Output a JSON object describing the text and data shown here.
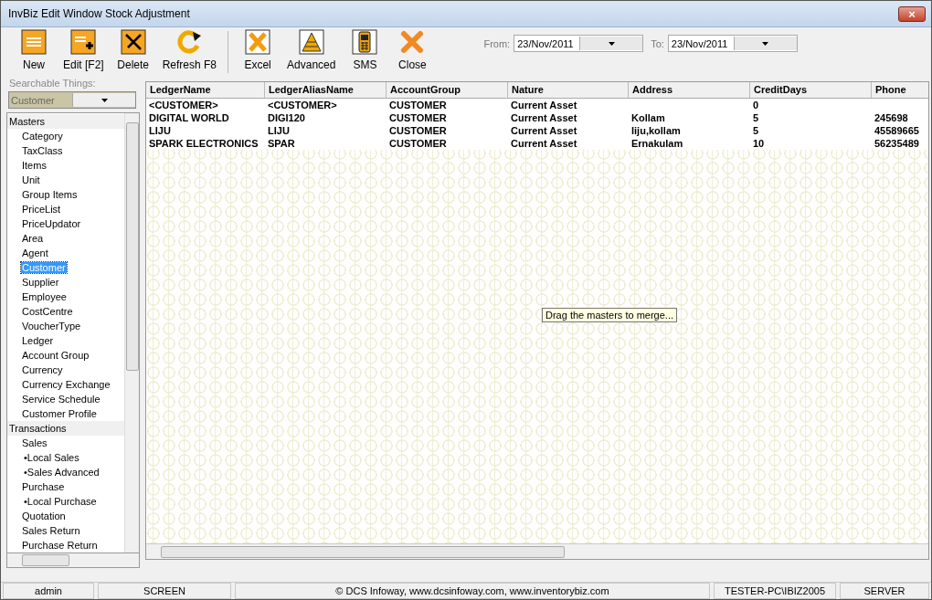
{
  "window": {
    "title": "InvBiz Edit Window Stock Adjustment",
    "close": "×"
  },
  "toolbar": [
    "New",
    "Edit [F2]",
    "Delete",
    "Refresh F8",
    "Excel",
    "Advanced",
    "SMS",
    "Close"
  ],
  "dates": [
    {
      "label": "From:",
      "value": "23/Nov/2011"
    },
    {
      "label": "To:",
      "value": "23/Nov/2011"
    }
  ],
  "search": {
    "label": "Searchable Things:",
    "value": "Customer"
  },
  "sidebar": {
    "items": [
      {
        "label": "Masters",
        "children": [
          {
            "label": "Category",
            "selected": false
          },
          {
            "label": "TaxClass",
            "selected": false
          },
          {
            "label": "Items",
            "selected": false
          },
          {
            "label": "Unit",
            "selected": false
          },
          {
            "label": "Group Items",
            "selected": false
          },
          {
            "label": "PriceList",
            "selected": false
          },
          {
            "label": "PriceUpdator",
            "selected": false
          },
          {
            "label": "Area",
            "selected": false
          },
          {
            "label": "Agent",
            "selected": false
          },
          {
            "label": "Customer",
            "selected": true
          },
          {
            "label": "Supplier",
            "selected": false
          },
          {
            "label": "Employee",
            "selected": false
          },
          {
            "label": "CostCentre",
            "selected": false
          },
          {
            "label": "VoucherType",
            "selected": false
          },
          {
            "label": "Ledger",
            "selected": false
          },
          {
            "label": "Account Group",
            "selected": false
          },
          {
            "label": "Currency",
            "selected": false
          },
          {
            "label": "Currency Exchange",
            "selected": false
          },
          {
            "label": "Service Schedule",
            "selected": false
          },
          {
            "label": "Customer Profile",
            "selected": false
          }
        ]
      },
      {
        "label": "Transactions",
        "children": [
          {
            "label": "Sales",
            "selected": false,
            "children": [
              {
                "label": "•Local Sales",
                "selected": false
              },
              {
                "label": "•Sales Advanced",
                "selected": false
              }
            ]
          },
          {
            "label": "Purchase",
            "selected": false,
            "children": [
              {
                "label": "•Local Purchase",
                "selected": false
              }
            ]
          },
          {
            "label": "Quotation",
            "selected": false
          },
          {
            "label": "Sales Return",
            "selected": false
          },
          {
            "label": "Purchase Return",
            "selected": false
          }
        ]
      }
    ]
  },
  "table": {
    "columns": [
      "LedgerName",
      "LedgerAliasName",
      "AccountGroup",
      "Nature",
      "Address",
      "CreditDays",
      "Phone"
    ],
    "rows": [
      [
        "<CUSTOMER>",
        "<CUSTOMER>",
        "CUSTOMER",
        "Current Asset",
        "",
        "0",
        ""
      ],
      [
        "DIGITAL WORLD",
        "DIGI120",
        "CUSTOMER",
        "Current Asset",
        "Kollam",
        "5",
        "245698"
      ],
      [
        "LIJU",
        "LIJU",
        "CUSTOMER",
        "Current Asset",
        "liju,kollam",
        "5",
        "45589665"
      ],
      [
        "SPARK ELECTRONICS",
        "SPAR",
        "CUSTOMER",
        "Current Asset",
        "Ernakulam",
        "10",
        "56235489"
      ]
    ]
  },
  "tooltip": "Drag the masters to merge...",
  "status_bar": [
    "admin",
    "SCREEN",
    "© DCS Infoway, www.dcsinfoway.com, www.inventorybiz.com",
    "TESTER-PC\\IBIZ2005",
    "SERVER"
  ]
}
